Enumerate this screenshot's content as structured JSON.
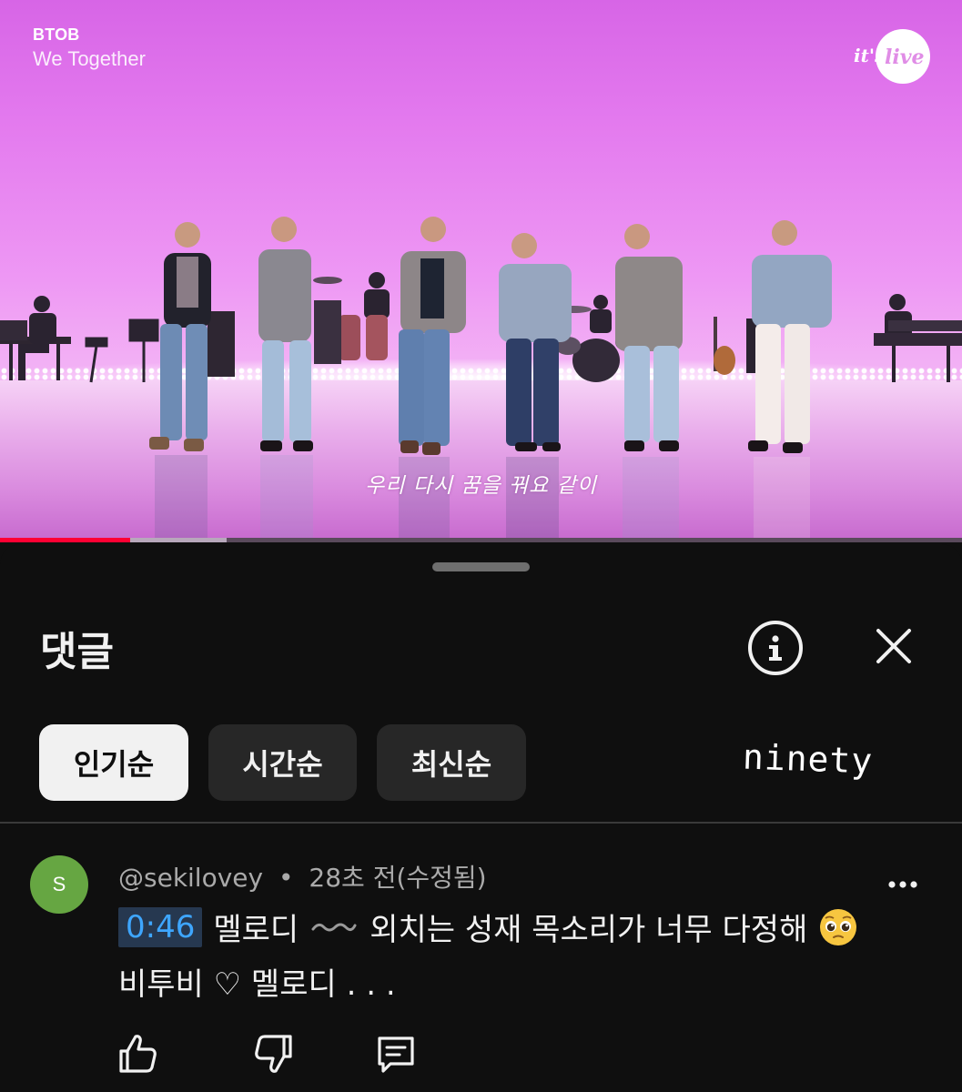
{
  "video": {
    "artist": "BTOB",
    "song": "We Together",
    "logo": "it's live",
    "subtitle": "우리 다시 꿈을 꿔요 같이",
    "progress": {
      "played_fraction": 0.135,
      "buffered_fraction": 0.235,
      "played_color": "#ff0033"
    }
  },
  "comments_panel": {
    "title": "댓글",
    "info_icon": "info-icon",
    "close_icon": "close-icon",
    "sort_chips": [
      {
        "label": "인기순",
        "active": true
      },
      {
        "label": "시간순",
        "active": false
      },
      {
        "label": "최신순",
        "active": false
      }
    ],
    "overlay_text": "ninety"
  },
  "comment": {
    "avatar_letter": "S",
    "avatar_color": "#66a642",
    "author": "@sekilovey",
    "separator": "•",
    "time": "28초 전(수정됨)",
    "timestamp_link": "0:46",
    "text_part1": "멜로디",
    "wave_glyph": "〰️",
    "text_part2": "외치는 성재 목소리가 너무 다정해",
    "emoji": "pleading-face",
    "line2": "비투비 ♡ 멜로디 . . .",
    "actions": [
      "like-icon",
      "dislike-icon",
      "reply-icon"
    ],
    "link_color": "#3ea6ff"
  }
}
